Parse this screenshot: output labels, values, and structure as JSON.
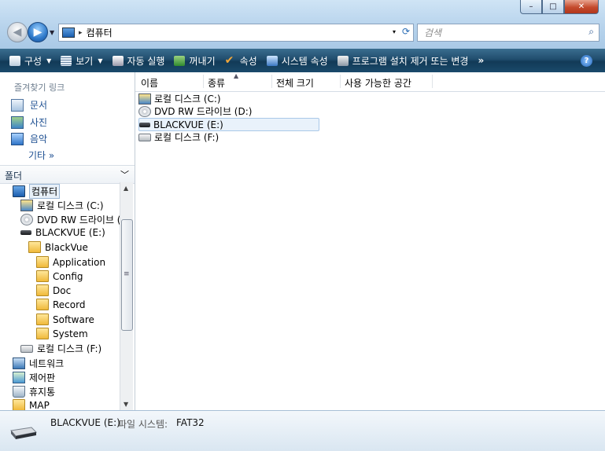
{
  "window": {
    "caption_buttons": {
      "minimize": "–",
      "maximize": "□",
      "close": "✕"
    }
  },
  "address": {
    "crumb": "컴퓨터",
    "separator": "▸",
    "dropdown": "▾",
    "refresh": "⟳"
  },
  "search": {
    "placeholder": "검색",
    "icon": "magnifier-icon"
  },
  "toolbar": {
    "organize": "구성",
    "views": "보기",
    "autoplay": "자동 실행",
    "eject": "꺼내기",
    "properties": "속성",
    "system_properties": "시스템 속성",
    "uninstall": "프로그램 설치 제거 또는 변경",
    "more": "»",
    "help": "?"
  },
  "favorites": {
    "title": "즐겨찾기 링크",
    "items": [
      {
        "label": "문서",
        "icon": "documents-icon"
      },
      {
        "label": "사진",
        "icon": "pictures-icon"
      },
      {
        "label": "음악",
        "icon": "music-icon"
      }
    ],
    "more": "기타 »"
  },
  "folders": {
    "title": "폴더",
    "tree": [
      {
        "label": "컴퓨터",
        "icon": "computer-icon"
      },
      {
        "label": "로컬 디스크 (C:)",
        "icon": "system-drive-icon"
      },
      {
        "label": "DVD RW 드라이브 (",
        "icon": "dvd-drive-icon"
      },
      {
        "label": "BLACKVUE (E:)",
        "icon": "usb-drive-icon"
      },
      {
        "label": "BlackVue",
        "icon": "folder-icon"
      },
      {
        "label": "Application",
        "icon": "folder-icon"
      },
      {
        "label": "Config",
        "icon": "folder-icon"
      },
      {
        "label": "Doc",
        "icon": "folder-icon"
      },
      {
        "label": "Record",
        "icon": "folder-icon"
      },
      {
        "label": "Software",
        "icon": "folder-icon"
      },
      {
        "label": "System",
        "icon": "folder-icon"
      },
      {
        "label": "로컬 디스크 (F:)",
        "icon": "hard-drive-icon"
      },
      {
        "label": "네트워크",
        "icon": "network-icon"
      },
      {
        "label": "제어판",
        "icon": "control-panel-icon"
      },
      {
        "label": "휴지통",
        "icon": "recycle-bin-icon"
      },
      {
        "label": "MAP",
        "icon": "folder-icon"
      }
    ]
  },
  "columns": [
    "이름",
    "종류",
    "전체 크기",
    "사용 가능한 공간"
  ],
  "items": [
    {
      "label": "로컬 디스크 (C:)",
      "icon": "system-drive-icon"
    },
    {
      "label": "DVD RW 드라이브 (D:)",
      "icon": "dvd-drive-icon"
    },
    {
      "label": "BLACKVUE (E:)",
      "icon": "usb-drive-icon",
      "selected": true
    },
    {
      "label": "로컬 디스크 (F:)",
      "icon": "hard-drive-icon"
    }
  ],
  "details": {
    "name": "BLACKVUE (E:)",
    "meta_label": "파일 시스템:",
    "meta_value": "FAT32"
  }
}
